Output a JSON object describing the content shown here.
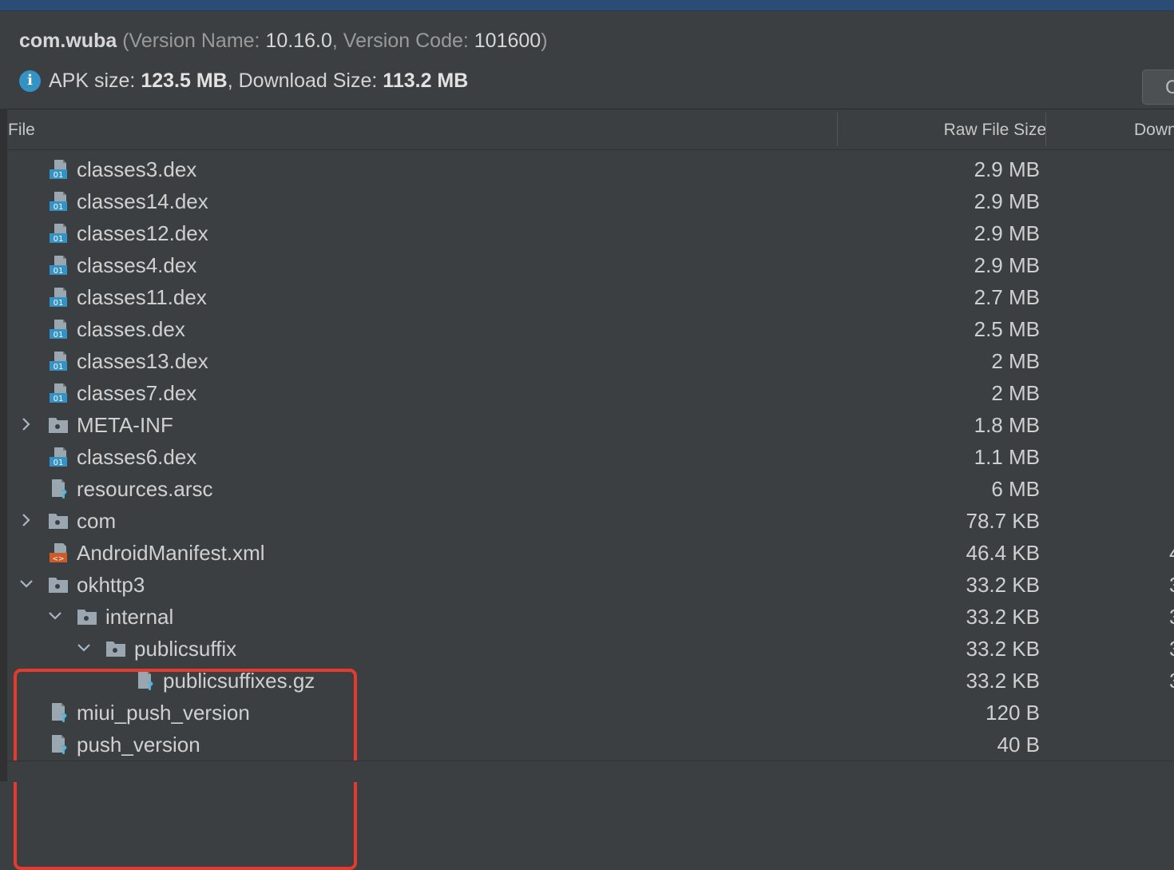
{
  "header": {
    "package": "com.wuba",
    "version_name_label": "Version Name:",
    "version_name": "10.16.0",
    "version_code_label": "Version Code:",
    "version_code": "101600",
    "apk_size_label": "APK size:",
    "apk_size": "123.5 MB",
    "download_size_label": "Download Size:",
    "download_size": "113.2 MB",
    "info_icon": "info-icon",
    "compare_button_label": "C"
  },
  "table": {
    "columns": {
      "file": "File",
      "raw_file_size": "Raw File Size",
      "download_size": "Down"
    },
    "rows": [
      {
        "name": "classes3.dex",
        "raw_size": "2.9 MB",
        "download_size": "",
        "icon": "dex-file-icon",
        "depth": 0,
        "expander": "none"
      },
      {
        "name": "classes14.dex",
        "raw_size": "2.9 MB",
        "download_size": "",
        "icon": "dex-file-icon",
        "depth": 0,
        "expander": "none"
      },
      {
        "name": "classes12.dex",
        "raw_size": "2.9 MB",
        "download_size": "",
        "icon": "dex-file-icon",
        "depth": 0,
        "expander": "none"
      },
      {
        "name": "classes4.dex",
        "raw_size": "2.9 MB",
        "download_size": "",
        "icon": "dex-file-icon",
        "depth": 0,
        "expander": "none"
      },
      {
        "name": "classes11.dex",
        "raw_size": "2.7 MB",
        "download_size": "",
        "icon": "dex-file-icon",
        "depth": 0,
        "expander": "none"
      },
      {
        "name": "classes.dex",
        "raw_size": "2.5 MB",
        "download_size": "",
        "icon": "dex-file-icon",
        "depth": 0,
        "expander": "none"
      },
      {
        "name": "classes13.dex",
        "raw_size": "2 MB",
        "download_size": "",
        "icon": "dex-file-icon",
        "depth": 0,
        "expander": "none"
      },
      {
        "name": "classes7.dex",
        "raw_size": "2 MB",
        "download_size": "",
        "icon": "dex-file-icon",
        "depth": 0,
        "expander": "none"
      },
      {
        "name": "META-INF",
        "raw_size": "1.8 MB",
        "download_size": "",
        "icon": "folder-icon",
        "depth": 0,
        "expander": "collapsed"
      },
      {
        "name": "classes6.dex",
        "raw_size": "1.1 MB",
        "download_size": "",
        "icon": "dex-file-icon",
        "depth": 0,
        "expander": "none"
      },
      {
        "name": "resources.arsc",
        "raw_size": "6 MB",
        "download_size": "",
        "icon": "unknown-file-icon",
        "depth": 0,
        "expander": "none"
      },
      {
        "name": "com",
        "raw_size": "78.7 KB",
        "download_size": "",
        "icon": "folder-icon",
        "depth": 0,
        "expander": "collapsed"
      },
      {
        "name": "AndroidManifest.xml",
        "raw_size": "46.4 KB",
        "download_size": "4",
        "icon": "xml-file-icon",
        "depth": 0,
        "expander": "none"
      },
      {
        "name": "okhttp3",
        "raw_size": "33.2 KB",
        "download_size": "3",
        "icon": "folder-icon",
        "depth": 0,
        "expander": "expanded"
      },
      {
        "name": "internal",
        "raw_size": "33.2 KB",
        "download_size": "3",
        "icon": "folder-icon",
        "depth": 1,
        "expander": "expanded"
      },
      {
        "name": "publicsuffix",
        "raw_size": "33.2 KB",
        "download_size": "3",
        "icon": "folder-icon",
        "depth": 2,
        "expander": "expanded"
      },
      {
        "name": "publicsuffixes.gz",
        "raw_size": "33.2 KB",
        "download_size": "3",
        "icon": "unknown-file-icon",
        "depth": 3,
        "expander": "none"
      },
      {
        "name": "miui_push_version",
        "raw_size": "120 B",
        "download_size": "",
        "icon": "unknown-file-icon",
        "depth": 0,
        "expander": "none"
      },
      {
        "name": "push_version",
        "raw_size": "40 B",
        "download_size": "",
        "icon": "unknown-file-icon",
        "depth": 0,
        "expander": "none"
      }
    ]
  },
  "colors": {
    "background": "#3c3f41",
    "highlight": "#e53a2e",
    "info": "#3592c4",
    "dex_badge": "#3592c4",
    "xml_badge": "#cc5a2a"
  }
}
